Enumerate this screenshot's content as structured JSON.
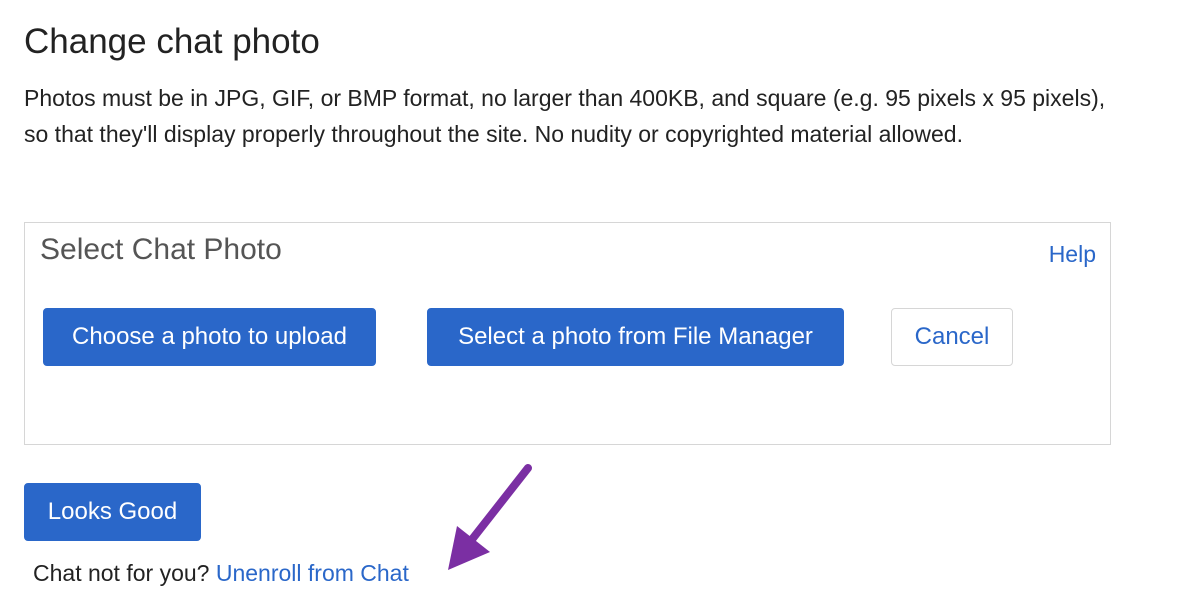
{
  "page": {
    "title": "Change chat photo",
    "intro": "Photos must be in JPG, GIF, or BMP format, no larger than 400KB, and square (e.g. 95 pixels x 95 pixels), so that they'll display properly throughout the site. No nudity or copyrighted material allowed."
  },
  "panel": {
    "title": "Select Chat Photo",
    "help_label": "Help",
    "buttons": {
      "upload_label": "Choose a photo to upload",
      "file_manager_label": "Select a photo from File Manager",
      "cancel_label": "Cancel"
    }
  },
  "footer": {
    "looks_good_label": "Looks Good",
    "unenroll_prompt": "Chat not for you?",
    "unenroll_link": "Unenroll from Chat"
  },
  "colors": {
    "accent": "#2a67c9",
    "annotation_arrow": "#7b2fa3",
    "border": "#d6d6d6"
  },
  "icons": {
    "annotation": "arrow-icon"
  }
}
